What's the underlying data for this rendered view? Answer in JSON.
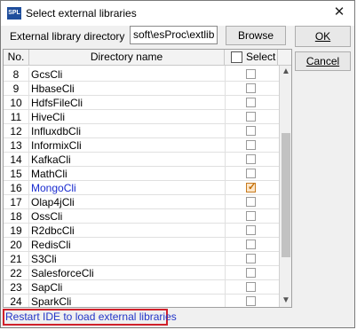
{
  "window": {
    "icon": "SPL",
    "title": "Select external libraries",
    "close_icon": "close-icon"
  },
  "directory": {
    "label": "External library directory",
    "value": "soft\\esProc\\extlib"
  },
  "buttons": {
    "browse": "Browse",
    "ok": "OK",
    "cancel": "Cancel"
  },
  "table": {
    "columns": {
      "no": "No.",
      "name": "Directory name",
      "select": "Select"
    },
    "rows": [
      {
        "no": "8",
        "name": "GcsCli",
        "checked": false
      },
      {
        "no": "9",
        "name": "HbaseCli",
        "checked": false
      },
      {
        "no": "10",
        "name": "HdfsFileCli",
        "checked": false
      },
      {
        "no": "11",
        "name": "HiveCli",
        "checked": false
      },
      {
        "no": "12",
        "name": "InfluxdbCli",
        "checked": false
      },
      {
        "no": "13",
        "name": "InformixCli",
        "checked": false
      },
      {
        "no": "14",
        "name": "KafkaCli",
        "checked": false
      },
      {
        "no": "15",
        "name": "MathCli",
        "checked": false
      },
      {
        "no": "16",
        "name": "MongoCli",
        "checked": true
      },
      {
        "no": "17",
        "name": "Olap4jCli",
        "checked": false
      },
      {
        "no": "18",
        "name": "OssCli",
        "checked": false
      },
      {
        "no": "19",
        "name": "R2dbcCli",
        "checked": false
      },
      {
        "no": "20",
        "name": "RedisCli",
        "checked": false
      },
      {
        "no": "21",
        "name": "S3Cli",
        "checked": false
      },
      {
        "no": "22",
        "name": "SalesforceCli",
        "checked": false
      },
      {
        "no": "23",
        "name": "SapCli",
        "checked": false
      },
      {
        "no": "24",
        "name": "SparkCli",
        "checked": false
      }
    ]
  },
  "status": {
    "message": "Restart IDE to load external libraries"
  },
  "colors": {
    "selected_text": "#1a2ccf",
    "status_text": "#2335c8",
    "status_border": "#d0202a",
    "check_fill": "#fde6c8"
  }
}
